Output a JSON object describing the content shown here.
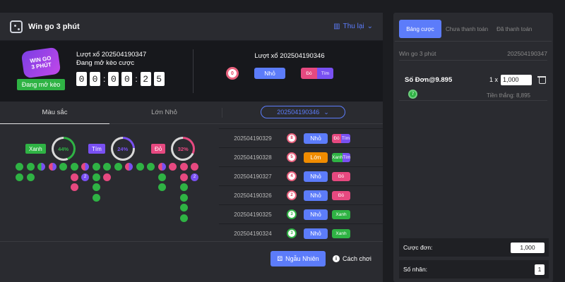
{
  "game": {
    "title": "Win go 3 phút",
    "retry_label": "Thu lại"
  },
  "logo": {
    "line1": "WIN GO",
    "line2": "3 PHÚT",
    "open_label": "Đang mở kèo"
  },
  "current": {
    "label": "Lượt xổ 202504190347",
    "status": "Đang mở kèo cược",
    "digits": [
      "0",
      "0",
      "0",
      "0",
      "2",
      "5"
    ]
  },
  "previous": {
    "label": "Lượt xổ 202504190346",
    "ball": "0",
    "size": "Nhỏ",
    "color_a": "Đỏ",
    "color_b": "Tím"
  },
  "tabs": {
    "color": "Màu sắc",
    "size": "Lớn Nhỏ",
    "period": "202504190346"
  },
  "stats": [
    {
      "label": "Xanh",
      "pct": "44%",
      "value": 44,
      "color": "#2fb344"
    },
    {
      "label": "Tím",
      "pct": "24%",
      "value": 24,
      "color": "#7950f2"
    },
    {
      "label": "Đỏ",
      "pct": "32%",
      "value": 32,
      "color": "#e64980"
    }
  ],
  "history": [
    {
      "period": "202504190329",
      "ball": "8",
      "ball_color": "red",
      "size": "Nhỏ",
      "size_color": "blue",
      "colors": [
        "Đỏ",
        "Tím"
      ]
    },
    {
      "period": "202504190328",
      "ball": "5",
      "ball_color": "red",
      "size": "Lớn",
      "size_color": "orange",
      "colors": [
        "Xanh",
        "Tím"
      ]
    },
    {
      "period": "202504190327",
      "ball": "4",
      "ball_color": "red",
      "size": "Nhỏ",
      "size_color": "blue",
      "colors": [
        "Đỏ"
      ]
    },
    {
      "period": "202504190326",
      "ball": "2",
      "ball_color": "red",
      "size": "Nhỏ",
      "size_color": "blue",
      "colors": [
        "Đỏ"
      ]
    },
    {
      "period": "202504190325",
      "ball": "3",
      "ball_color": "green",
      "size": "Nhỏ",
      "size_color": "blue",
      "colors": [
        "Xanh"
      ]
    },
    {
      "period": "202504190324",
      "ball": "3",
      "ball_color": "green",
      "size": "Nhỏ",
      "size_color": "blue",
      "colors": [
        "Xanh"
      ]
    }
  ],
  "footer": {
    "random_label": "Ngẫu Nhiên",
    "help_label": "Cách chơi"
  },
  "slip": {
    "tabs": [
      "Bảng cược",
      "Chưa thanh toán",
      "Đã thanh toán"
    ],
    "game": "Win go 3 phút",
    "period": "202504190347",
    "bet_name": "Số Đơn@9.895",
    "qty": "1 x",
    "amount": "1,000",
    "ball": "7",
    "win": "Tiền thắng: 8,895",
    "single_label": "Cược đơn:",
    "single_value": "1,000",
    "multi_label": "Số nhân:",
    "multi_value": "1"
  }
}
